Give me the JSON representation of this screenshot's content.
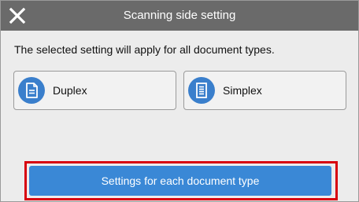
{
  "header": {
    "title": "Scanning side setting",
    "close_icon": "close-icon"
  },
  "message": "The selected setting will apply for all document types.",
  "options": [
    {
      "label": "Duplex",
      "icon": "duplex-document-icon"
    },
    {
      "label": "Simplex",
      "icon": "simplex-document-icon"
    }
  ],
  "primary_button": {
    "label": "Settings for each document type",
    "highlighted": true
  },
  "colors": {
    "titlebar": "#6a6a6a",
    "background": "#ececec",
    "accent": "#3a88d6",
    "icon_circle": "#3a7fcc",
    "highlight": "#d7000f"
  }
}
